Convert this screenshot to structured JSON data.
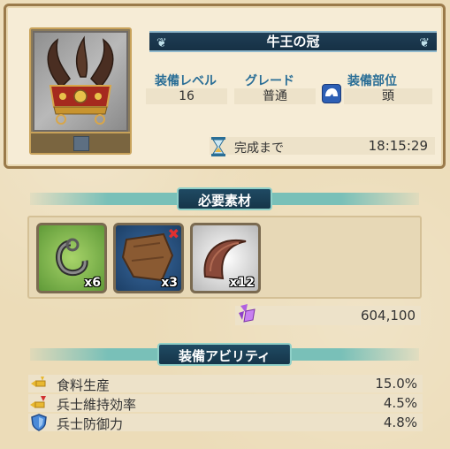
{
  "item": {
    "name": "牛王の冠",
    "icon": "bull-crown-icon"
  },
  "stats": {
    "level_label": "装備レベル",
    "level_value": "16",
    "grade_label": "グレード",
    "grade_value": "普通",
    "slot_label": "装備部位",
    "slot_value": "頭",
    "slot_icon": "helmet-icon"
  },
  "timer": {
    "label": "完成まで",
    "value": "18:15:29",
    "icon": "hourglass-icon"
  },
  "materials_section": {
    "title": "必要素材",
    "items": [
      {
        "icon": "ring-material-icon",
        "qty": "x6",
        "missing": false
      },
      {
        "icon": "leather-material-icon",
        "qty": "x3",
        "missing": true
      },
      {
        "icon": "horn-material-icon",
        "qty": "x12",
        "missing": false
      }
    ],
    "cost_icon": "gem-icon",
    "cost_value": "604,100"
  },
  "abilities_section": {
    "title": "装備アビリティ",
    "items": [
      {
        "icon": "food-icon",
        "name": "食料生産",
        "value": "15.0%"
      },
      {
        "icon": "upkeep-icon",
        "name": "兵士維持効率",
        "value": "4.5%"
      },
      {
        "icon": "shield-icon",
        "name": "兵士防御力",
        "value": "4.8%"
      }
    ]
  },
  "colors": {
    "banner": "#1f3d55",
    "label": "#2a6e96",
    "teal": "#79c0b8"
  }
}
